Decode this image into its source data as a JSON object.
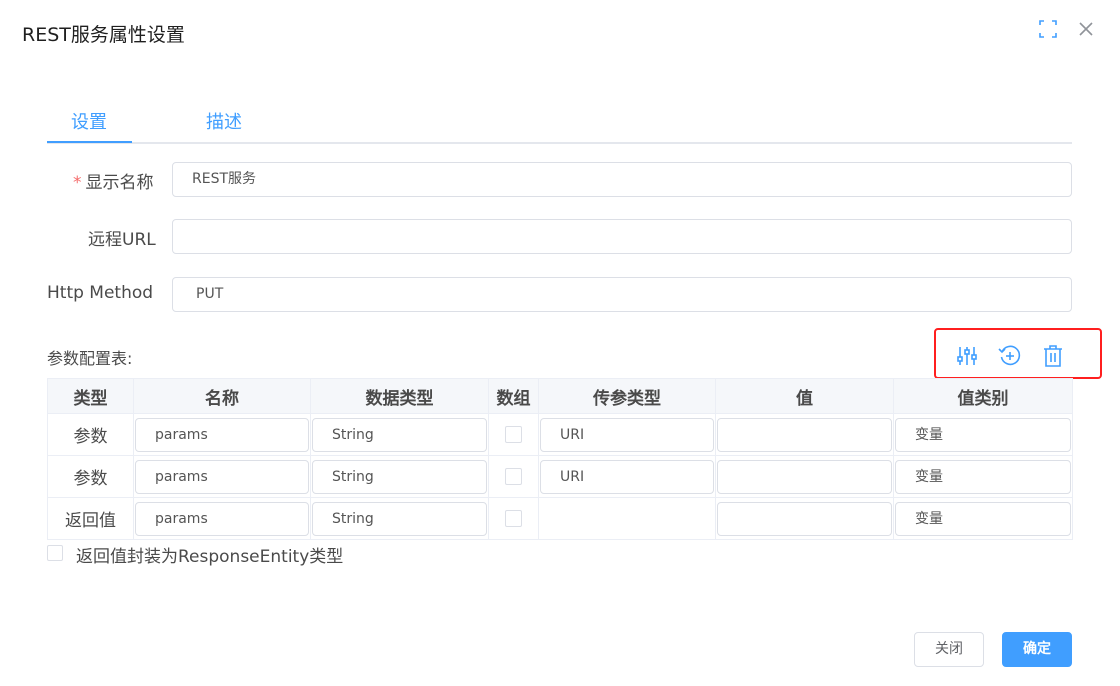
{
  "dialog": {
    "title": "REST服务属性设置"
  },
  "tabs": [
    {
      "label": "设置"
    },
    {
      "label": "描述"
    }
  ],
  "form": {
    "display_name": {
      "required_mark": "*",
      "label": "显示名称",
      "value": "REST服务"
    },
    "remote_url": {
      "label": "远程URL",
      "value": ""
    },
    "http_method": {
      "label": "Http Method",
      "value": "PUT"
    }
  },
  "params": {
    "label": "参数配置表:",
    "toolbar": {
      "icons": [
        "settings-sliders-icon",
        "add-circle-icon",
        "delete-icon"
      ]
    },
    "headers": [
      "类型",
      "名称",
      "数据类型",
      "数组",
      "传参类型",
      "值",
      "值类别"
    ],
    "rows": [
      {
        "kind": "参数",
        "name": "params",
        "data_type": "String",
        "is_array": false,
        "pass_type": "URI",
        "value": "",
        "value_category": "变量"
      },
      {
        "kind": "参数",
        "name": "params",
        "data_type": "String",
        "is_array": false,
        "pass_type": "URI",
        "value": "",
        "value_category": "变量"
      },
      {
        "kind": "返回值",
        "name": "params",
        "data_type": "String",
        "is_array": false,
        "pass_type": "",
        "value": "",
        "value_category": "变量"
      }
    ]
  },
  "wrap_response": {
    "label": "返回值封装为ResponseEntity类型",
    "checked": false
  },
  "footer": {
    "close_label": "关闭",
    "ok_label": "确定"
  },
  "colors": {
    "primary": "#409eff",
    "highlight_box": "#ff1f1f",
    "required": "#f56c6c"
  }
}
